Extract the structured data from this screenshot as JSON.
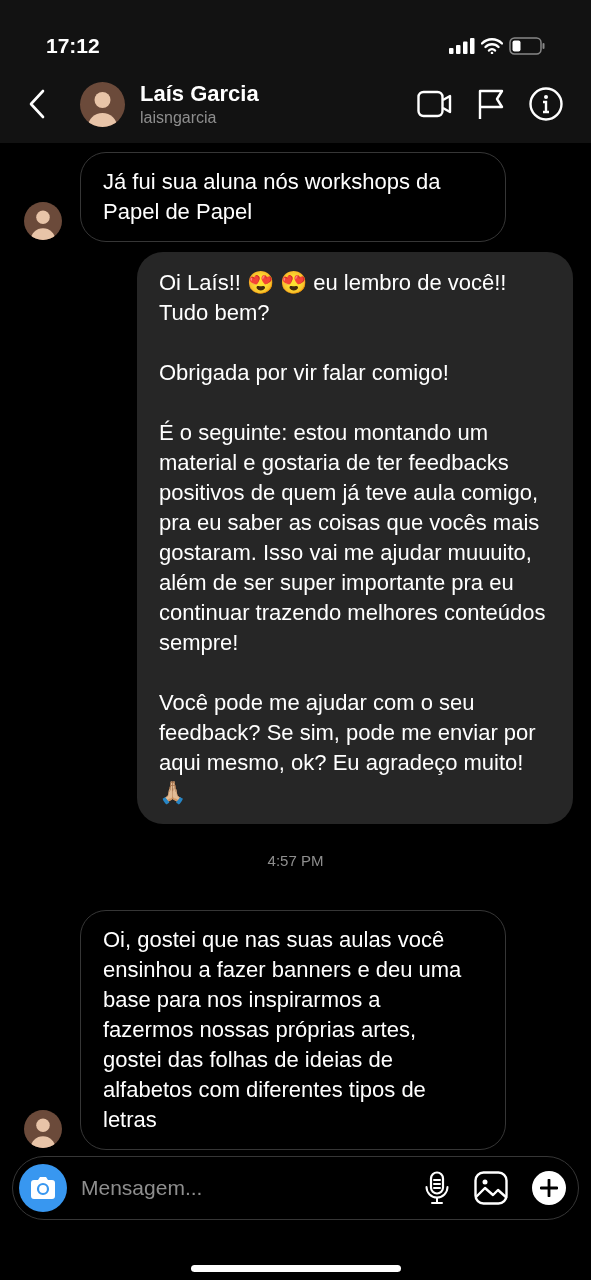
{
  "status_bar": {
    "time": "17:12"
  },
  "header": {
    "name": "Laís Garcia",
    "username": "laisngarcia"
  },
  "messages": [
    {
      "kind": "incoming",
      "avatar": true,
      "paragraphs": [
        "Já fui sua aluna nós workshops da Papel de Papel"
      ]
    },
    {
      "kind": "outgoing",
      "paragraphs": [
        "Oi Laís!! 😍 😍 eu lembro de você!! Tudo bem?",
        "Obrigada por vir falar comigo!",
        "É o seguinte: estou montando um material e gostaria de ter feedbacks positivos de quem já teve aula comigo, pra eu saber as coisas que vocês mais gostaram. Isso vai me ajudar muuuito, além de ser super importante pra eu continuar trazendo melhores conteúdos sempre!",
        "Você pode me ajudar com o seu feedback? Se sim, pode me enviar por aqui mesmo, ok? Eu agradeço muito! 🙏🏼"
      ]
    },
    {
      "kind": "timestamp",
      "text": "4:57 PM"
    },
    {
      "kind": "incoming",
      "avatar": true,
      "paragraphs": [
        "Oi, gostei que nas suas aulas você ensinhou a fazer banners e deu uma base para nos inspirarmos a fazermos nossas próprias artes, gostei das folhas de ideias de alfabetos com diferentes tipos de letras"
      ]
    }
  ],
  "composer": {
    "placeholder": "Mensagem..."
  }
}
